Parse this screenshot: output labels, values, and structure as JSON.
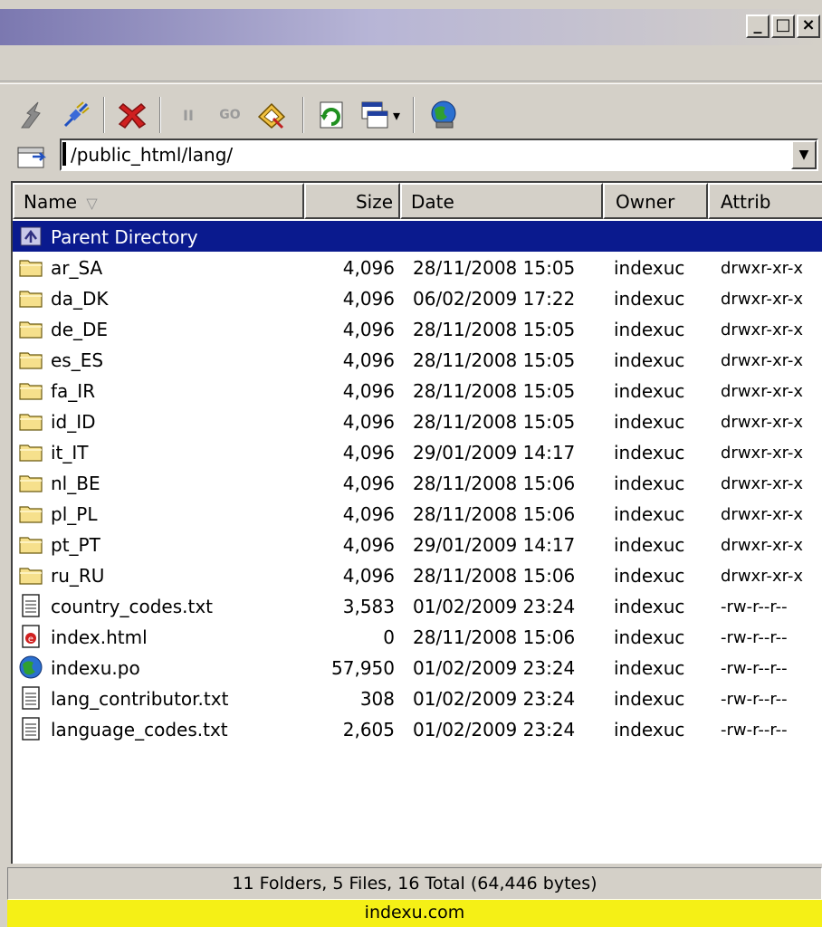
{
  "window": {
    "minimize_label": "_",
    "maximize_label": "□",
    "close_label": "×"
  },
  "toolbar": {
    "buttons": [
      {
        "name": "disconnect-icon"
      },
      {
        "name": "connect-icon"
      },
      {
        "name": "abort-icon"
      },
      {
        "name": "pause-icon",
        "label": "II"
      },
      {
        "name": "go-icon",
        "label": "GO"
      },
      {
        "name": "edit-icon"
      },
      {
        "name": "refresh-icon"
      },
      {
        "name": "view-icon"
      },
      {
        "name": "browser-icon"
      }
    ],
    "dropdown_arrow": "▾"
  },
  "path": {
    "value": "/public_html/lang/",
    "dropdown_arrow": "▼"
  },
  "columns": {
    "name": "Name",
    "sort_indicator": "▽",
    "size": "Size",
    "date": "Date",
    "owner": "Owner",
    "attrib": "Attrib"
  },
  "rows": [
    {
      "icon": "parent-directory-icon",
      "name": "Parent Directory",
      "size": "",
      "date": "",
      "owner": "",
      "attrib": "",
      "selected": true
    },
    {
      "icon": "folder-icon",
      "name": "ar_SA",
      "size": "4,096",
      "date": "28/11/2008 15:05",
      "owner": "indexuc",
      "attrib": "drwxr-xr-x"
    },
    {
      "icon": "folder-icon",
      "name": "da_DK",
      "size": "4,096",
      "date": "06/02/2009 17:22",
      "owner": "indexuc",
      "attrib": "drwxr-xr-x"
    },
    {
      "icon": "folder-icon",
      "name": "de_DE",
      "size": "4,096",
      "date": "28/11/2008 15:05",
      "owner": "indexuc",
      "attrib": "drwxr-xr-x"
    },
    {
      "icon": "folder-icon",
      "name": "es_ES",
      "size": "4,096",
      "date": "28/11/2008 15:05",
      "owner": "indexuc",
      "attrib": "drwxr-xr-x"
    },
    {
      "icon": "folder-icon",
      "name": "fa_IR",
      "size": "4,096",
      "date": "28/11/2008 15:05",
      "owner": "indexuc",
      "attrib": "drwxr-xr-x"
    },
    {
      "icon": "folder-icon",
      "name": "id_ID",
      "size": "4,096",
      "date": "28/11/2008 15:05",
      "owner": "indexuc",
      "attrib": "drwxr-xr-x"
    },
    {
      "icon": "folder-icon",
      "name": "it_IT",
      "size": "4,096",
      "date": "29/01/2009 14:17",
      "owner": "indexuc",
      "attrib": "drwxr-xr-x"
    },
    {
      "icon": "folder-icon",
      "name": "nl_BE",
      "size": "4,096",
      "date": "28/11/2008 15:06",
      "owner": "indexuc",
      "attrib": "drwxr-xr-x"
    },
    {
      "icon": "folder-icon",
      "name": "pl_PL",
      "size": "4,096",
      "date": "28/11/2008 15:06",
      "owner": "indexuc",
      "attrib": "drwxr-xr-x"
    },
    {
      "icon": "folder-icon",
      "name": "pt_PT",
      "size": "4,096",
      "date": "29/01/2009 14:17",
      "owner": "indexuc",
      "attrib": "drwxr-xr-x"
    },
    {
      "icon": "folder-icon",
      "name": "ru_RU",
      "size": "4,096",
      "date": "28/11/2008 15:06",
      "owner": "indexuc",
      "attrib": "drwxr-xr-x"
    },
    {
      "icon": "text-file-icon",
      "name": "country_codes.txt",
      "size": "3,583",
      "date": "01/02/2009 23:24",
      "owner": "indexuc",
      "attrib": "-rw-r--r--"
    },
    {
      "icon": "html-file-icon",
      "name": "index.html",
      "size": "0",
      "date": "28/11/2008 15:06",
      "owner": "indexuc",
      "attrib": "-rw-r--r--"
    },
    {
      "icon": "globe-file-icon",
      "name": "indexu.po",
      "size": "57,950",
      "date": "01/02/2009 23:24",
      "owner": "indexuc",
      "attrib": "-rw-r--r--"
    },
    {
      "icon": "text-file-icon",
      "name": "lang_contributor.txt",
      "size": "308",
      "date": "01/02/2009 23:24",
      "owner": "indexuc",
      "attrib": "-rw-r--r--"
    },
    {
      "icon": "text-file-icon",
      "name": "language_codes.txt",
      "size": "2,605",
      "date": "01/02/2009 23:24",
      "owner": "indexuc",
      "attrib": "-rw-r--r--"
    }
  ],
  "status": "11 Folders, 5 Files, 16 Total (64,446 bytes)",
  "banner": "indexu.com",
  "colors": {
    "selection": "#0a1a8e",
    "banner": "#f5f016",
    "folder": "#f6e08c"
  }
}
